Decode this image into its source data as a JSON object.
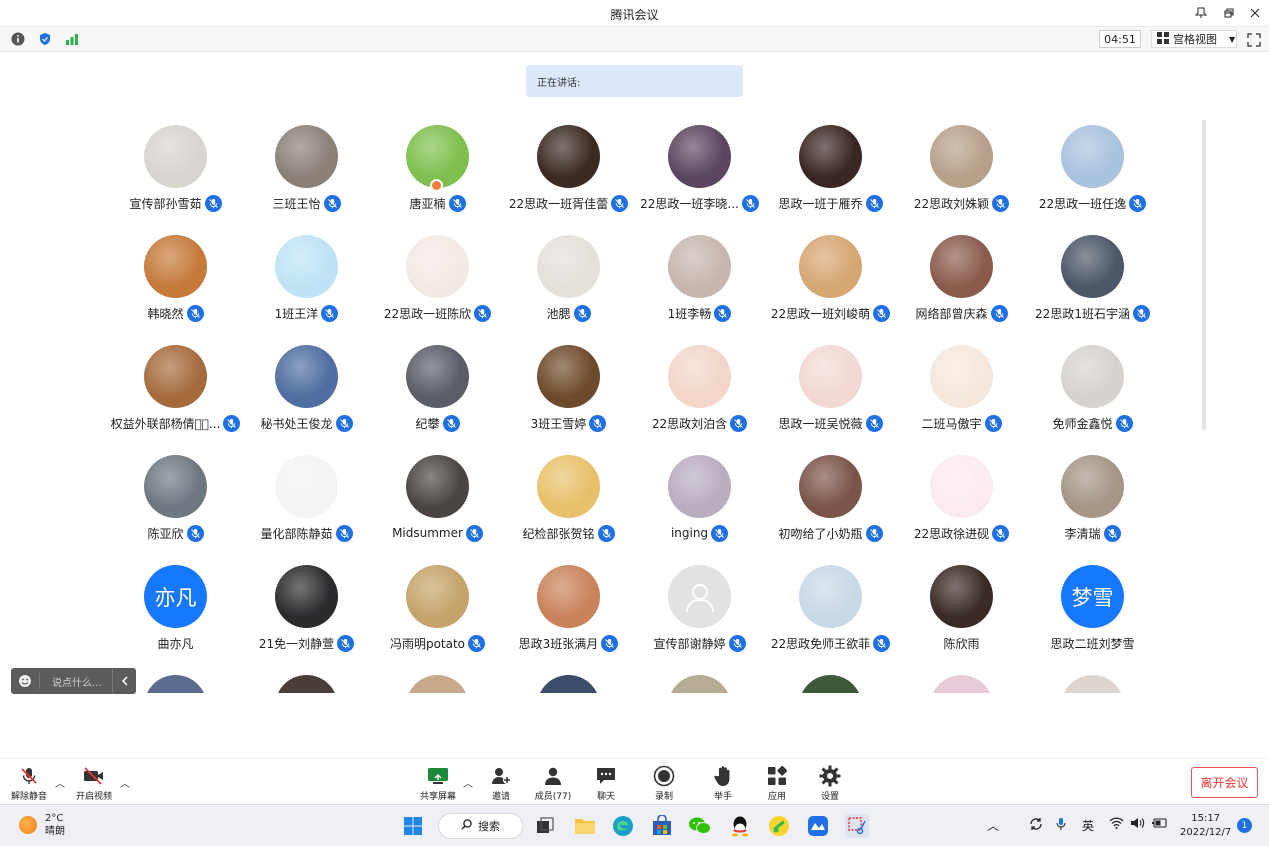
{
  "window": {
    "title": "腾讯会议"
  },
  "infobar": {
    "timer": "04:51",
    "view_label": "宫格视图"
  },
  "speaking": {
    "label": "正在讲话:"
  },
  "participants": [
    {
      "name": "宣传部孙雪茹",
      "bg": "#d8d4cf"
    },
    {
      "name": "三班王怡",
      "bg": "#8a8078"
    },
    {
      "name": "唐亚楠",
      "bg": "#7fbf4d",
      "host": true
    },
    {
      "name": "22思政一班胥佳蕾",
      "bg": "#3b2a22"
    },
    {
      "name": "22思政一班李晓...",
      "bg": "#5a4660"
    },
    {
      "name": "思政一班于雁乔",
      "bg": "#3a2624"
    },
    {
      "name": "22思政刘姝颖",
      "bg": "#b7a08a"
    },
    {
      "name": "22思政一班任逸",
      "bg": "#a9c2de"
    },
    {
      "name": "韩晓然",
      "bg": "#c57a3a"
    },
    {
      "name": "1班王洋",
      "bg": "#bfe3f5"
    },
    {
      "name": "22思政一班陈欣",
      "bg": "#f3e9e4"
    },
    {
      "name": "池腮",
      "bg": "#e4e0da"
    },
    {
      "name": "1班李畅",
      "bg": "#c7b6ae"
    },
    {
      "name": "22思政一班刘峻萌",
      "bg": "#d6a673"
    },
    {
      "name": "网络部曾庆森",
      "bg": "#8a5b4c"
    },
    {
      "name": "22思政1班石宇涵",
      "bg": "#4b5667"
    },
    {
      "name": "权益外联部杨倩𫕩𫕩...",
      "bg": "#a56b3d"
    },
    {
      "name": "秘书处王俊龙",
      "bg": "#4f6da0"
    },
    {
      "name": "纪攀",
      "bg": "#5b5d66"
    },
    {
      "name": "3班王雪婷",
      "bg": "#6d4a2b"
    },
    {
      "name": "22思政刘泊含",
      "bg": "#f2d6c8"
    },
    {
      "name": "思政一班吴悦薇",
      "bg": "#f1d8d2"
    },
    {
      "name": "二班马傲宇",
      "bg": "#f5e7dc"
    },
    {
      "name": "免师金鑫悦",
      "bg": "#d8d2ce"
    },
    {
      "name": "陈亚欣",
      "bg": "#6e7780"
    },
    {
      "name": "量化部陈静茹",
      "bg": "#f4f4f4"
    },
    {
      "name": "Midsummer",
      "bg": "#4a4442"
    },
    {
      "name": "纪检部张贺铭",
      "bg": "#e8c06a"
    },
    {
      "name": "inging",
      "bg": "#b9adc0"
    },
    {
      "name": "初吻给了小奶瓶",
      "bg": "#7a5448"
    },
    {
      "name": "22思政徐进砚",
      "bg": "#fbeaf0"
    },
    {
      "name": "李清瑞",
      "bg": "#a59686"
    },
    {
      "name": "曲亦凡",
      "bg": "#1677ff",
      "initials": "亦凡"
    },
    {
      "name": "21免一刘静萱",
      "bg": "#2b2b2e"
    },
    {
      "name": "冯雨明potato",
      "bg": "#c4a46a"
    },
    {
      "name": "思政3班张满月",
      "bg": "#c9825a"
    },
    {
      "name": "宣传部谢静婷",
      "bg": "#e2e2e2",
      "placeholder": true
    },
    {
      "name": "22思政免师王欲菲",
      "bg": "#c9d8e6"
    },
    {
      "name": "陈欣雨",
      "bg": "#3a2a26"
    },
    {
      "name": "思政二班刘梦雪",
      "bg": "#1677ff",
      "initials": "梦雪"
    }
  ],
  "partial_row": [
    "#5b6c8e",
    "#4a3c36",
    "#c8a98c",
    "#3c4d6a",
    "#b8ab94",
    "#3c5a3a",
    "#e8c9d8",
    "#ddd3cf"
  ],
  "chat": {
    "placeholder": "说点什么..."
  },
  "toolbar": {
    "unmute": "解除静音",
    "start_video": "开启视频",
    "share_screen": "共享屏幕",
    "invite": "邀请",
    "members": "成员(77)",
    "chat": "聊天",
    "record": "录制",
    "raise_hand": "举手",
    "apps": "应用",
    "settings": "设置",
    "leave": "离开会议"
  },
  "taskbar": {
    "temperature": "2°C",
    "weather": "晴朗",
    "search": "搜索",
    "ime": "英",
    "time": "15:17",
    "date": "2022/12/7",
    "notifications": "1"
  }
}
